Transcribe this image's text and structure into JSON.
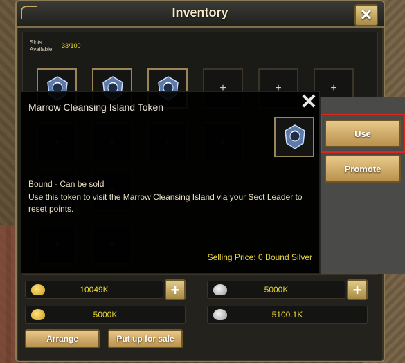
{
  "window": {
    "title": "Inventory"
  },
  "slots": {
    "label": "Slots Available:",
    "count": "33/100"
  },
  "tooltip": {
    "item_name": "Marrow Cleansing Island Token",
    "bound_text": "Bound - Can be sold",
    "description": "Use this token to visit the Marrow Cleansing Island via your Sect Leader to reset points.",
    "selling_price": "Selling Price: 0 Bound Silver"
  },
  "actions": {
    "use_label": "Use",
    "promote_label": "Promote"
  },
  "currency": {
    "gold": "10049K",
    "bound_gold": "5000K",
    "silver": "5000K",
    "bound_silver": "5100.1K"
  },
  "buttons": {
    "arrange_label": "Arrange",
    "sell_label": "Put up for sale"
  },
  "icons": {
    "close": "close-icon",
    "plus": "plus-icon",
    "gold": "gold-ingot-icon",
    "silver": "silver-ingot-icon"
  },
  "colors": {
    "accent_gold": "#e7d43a",
    "button_gold": "#d8b26a",
    "highlight_red": "#e02418"
  }
}
